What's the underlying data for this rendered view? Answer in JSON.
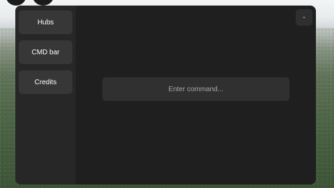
{
  "sidebar": {
    "items": [
      {
        "label": "Hubs"
      },
      {
        "label": "CMD bar"
      },
      {
        "label": "Credits"
      }
    ]
  },
  "header": {
    "minimize_label": "-"
  },
  "command": {
    "placeholder": "Enter command...",
    "value": ""
  },
  "colors": {
    "window_bg": "#1f1f1f",
    "sidebar_bg": "#272727",
    "button_bg": "#373737",
    "input_bg": "#303030"
  }
}
